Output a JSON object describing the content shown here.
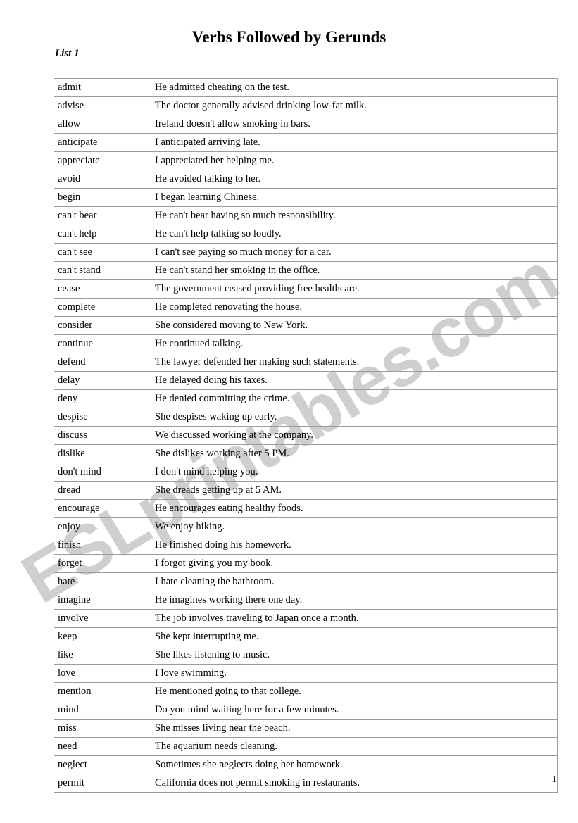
{
  "document": {
    "title": "Verbs Followed by Gerunds",
    "list_label": "List 1",
    "page_number": "1",
    "watermark": "ESLprintables.com",
    "watermark_color": "#cfcfcf",
    "border_color": "#9c9c9c",
    "background_color": "#ffffff",
    "text_color": "#000000"
  },
  "table": {
    "columns": [
      "verb",
      "example_sentence"
    ],
    "rows": [
      {
        "verb": "admit",
        "sentence": "He admitted cheating on the test."
      },
      {
        "verb": "advise",
        "sentence": "The doctor generally advised drinking low-fat milk."
      },
      {
        "verb": "allow",
        "sentence": "Ireland doesn't allow smoking in bars."
      },
      {
        "verb": "anticipate",
        "sentence": "I anticipated arriving late."
      },
      {
        "verb": "appreciate",
        "sentence": "I appreciated her helping me."
      },
      {
        "verb": "avoid",
        "sentence": "He avoided talking to her."
      },
      {
        "verb": "begin",
        "sentence": "I began learning Chinese."
      },
      {
        "verb": "can't bear",
        "sentence": "He can't bear having so much responsibility."
      },
      {
        "verb": "can't help",
        "sentence": "He can't help talking so loudly."
      },
      {
        "verb": "can't see",
        "sentence": "I can't see paying so much money for a car."
      },
      {
        "verb": "can't stand",
        "sentence": "He can't stand her smoking in the office."
      },
      {
        "verb": "cease",
        "sentence": "The government ceased providing free healthcare."
      },
      {
        "verb": "complete",
        "sentence": "He completed renovating the house."
      },
      {
        "verb": "consider",
        "sentence": "She considered moving to New York."
      },
      {
        "verb": "continue",
        "sentence": "He continued talking."
      },
      {
        "verb": "defend",
        "sentence": "The lawyer defended her making such statements."
      },
      {
        "verb": "delay",
        "sentence": "He delayed doing his taxes."
      },
      {
        "verb": "deny",
        "sentence": "He denied committing the crime."
      },
      {
        "verb": "despise",
        "sentence": "She despises waking up early."
      },
      {
        "verb": "discuss",
        "sentence": "We discussed working at the company."
      },
      {
        "verb": "dislike",
        "sentence": "She dislikes working after 5 PM."
      },
      {
        "verb": "don't mind",
        "sentence": "I don't mind helping you."
      },
      {
        "verb": "dread",
        "sentence": "She dreads getting up at 5  AM."
      },
      {
        "verb": "encourage",
        "sentence": "He encourages eating healthy foods."
      },
      {
        "verb": "enjoy",
        "sentence": "We enjoy hiking."
      },
      {
        "verb": "finish",
        "sentence": "He finished doing his homework."
      },
      {
        "verb": "forget",
        "sentence": "I forgot giving you my book."
      },
      {
        "verb": "hate",
        "sentence": "I hate cleaning the bathroom."
      },
      {
        "verb": "imagine",
        "sentence": "He imagines working there one day."
      },
      {
        "verb": "involve",
        "sentence": "The job involves traveling to Japan once a month."
      },
      {
        "verb": "keep",
        "sentence": "She kept interrupting me."
      },
      {
        "verb": "like",
        "sentence": "She likes listening to music."
      },
      {
        "verb": "love",
        "sentence": "I love swimming."
      },
      {
        "verb": "mention",
        "sentence": "He mentioned going to that college."
      },
      {
        "verb": "mind",
        "sentence": "Do you mind waiting here for a few minutes."
      },
      {
        "verb": "miss",
        "sentence": "She misses living near the beach."
      },
      {
        "verb": "need",
        "sentence": "The aquarium needs cleaning."
      },
      {
        "verb": "neglect",
        "sentence": "Sometimes she neglects doing her homework."
      },
      {
        "verb": "permit",
        "sentence": "California does not permit smoking in restaurants."
      }
    ]
  }
}
